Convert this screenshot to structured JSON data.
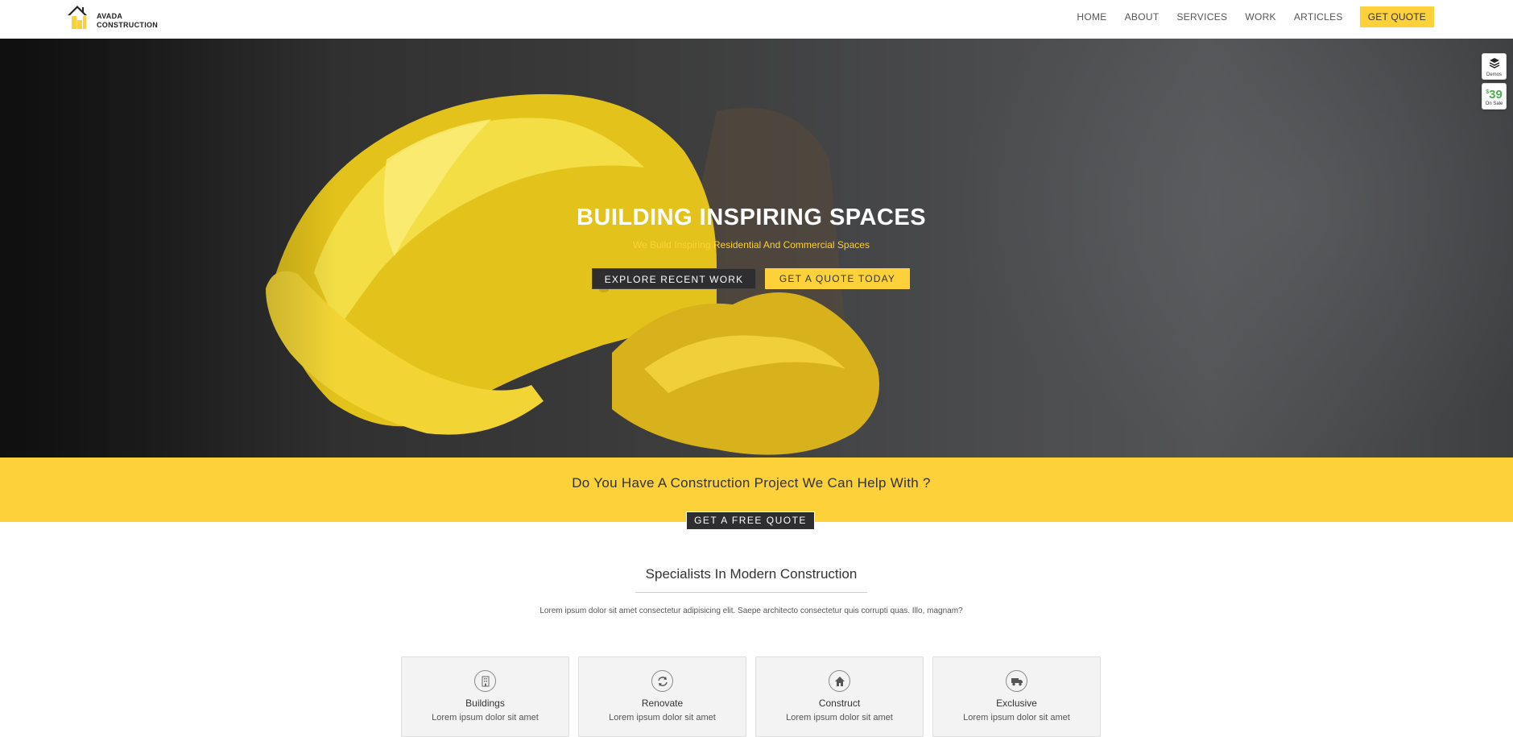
{
  "brand": {
    "line1": "AVADA",
    "line2": "CONSTRUCTION",
    "accent": "#fdd13a"
  },
  "nav": {
    "items": [
      "HOME",
      "ABOUT",
      "SERVICES",
      "WORK",
      "ARTICLES"
    ],
    "cta": "GET QUOTE"
  },
  "hero": {
    "title": "BUILDING INSPIRING SPACES",
    "subtitle": "We Build Inspiring Residential And Commercial Spaces",
    "btn_primary": "EXPLORE RECENT WORK",
    "btn_secondary": "GET A QUOTE TODAY"
  },
  "side": {
    "demos_label": "Demos",
    "price": "39",
    "currency": "$",
    "sale_label": "On Sale"
  },
  "cta_band": {
    "text": "Do You Have A Construction Project We Can Help With ?",
    "button": "GET A FREE QUOTE"
  },
  "specialists": {
    "title": "Specialists In Modern Construction",
    "description": "Lorem ipsum dolor sit amet consectetur adipisicing elit. Saepe architecto consectetur quis corrupti quas. Illo, magnam?",
    "cards": [
      {
        "title": "Buildings",
        "text": "Lorem ipsum dolor sit amet",
        "icon": "building-icon"
      },
      {
        "title": "Renovate",
        "text": "Lorem ipsum dolor sit amet",
        "icon": "refresh-icon"
      },
      {
        "title": "Construct",
        "text": "Lorem ipsum dolor sit amet",
        "icon": "home-icon"
      },
      {
        "title": "Exclusive",
        "text": "Lorem ipsum dolor sit amet",
        "icon": "truck-icon"
      }
    ]
  }
}
